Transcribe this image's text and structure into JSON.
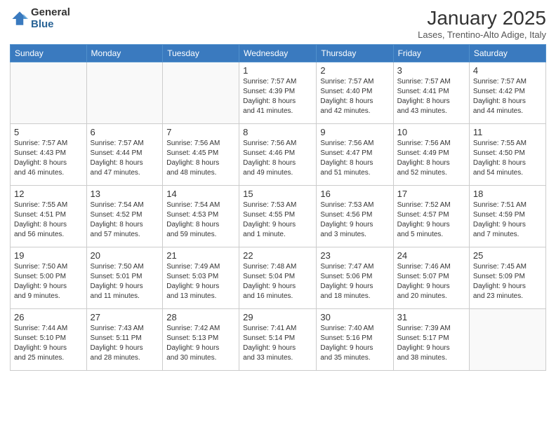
{
  "logo": {
    "general": "General",
    "blue": "Blue"
  },
  "header": {
    "month": "January 2025",
    "location": "Lases, Trentino-Alto Adige, Italy"
  },
  "weekdays": [
    "Sunday",
    "Monday",
    "Tuesday",
    "Wednesday",
    "Thursday",
    "Friday",
    "Saturday"
  ],
  "weeks": [
    [
      {
        "day": "",
        "detail": ""
      },
      {
        "day": "",
        "detail": ""
      },
      {
        "day": "",
        "detail": ""
      },
      {
        "day": "1",
        "detail": "Sunrise: 7:57 AM\nSunset: 4:39 PM\nDaylight: 8 hours\nand 41 minutes."
      },
      {
        "day": "2",
        "detail": "Sunrise: 7:57 AM\nSunset: 4:40 PM\nDaylight: 8 hours\nand 42 minutes."
      },
      {
        "day": "3",
        "detail": "Sunrise: 7:57 AM\nSunset: 4:41 PM\nDaylight: 8 hours\nand 43 minutes."
      },
      {
        "day": "4",
        "detail": "Sunrise: 7:57 AM\nSunset: 4:42 PM\nDaylight: 8 hours\nand 44 minutes."
      }
    ],
    [
      {
        "day": "5",
        "detail": "Sunrise: 7:57 AM\nSunset: 4:43 PM\nDaylight: 8 hours\nand 46 minutes."
      },
      {
        "day": "6",
        "detail": "Sunrise: 7:57 AM\nSunset: 4:44 PM\nDaylight: 8 hours\nand 47 minutes."
      },
      {
        "day": "7",
        "detail": "Sunrise: 7:56 AM\nSunset: 4:45 PM\nDaylight: 8 hours\nand 48 minutes."
      },
      {
        "day": "8",
        "detail": "Sunrise: 7:56 AM\nSunset: 4:46 PM\nDaylight: 8 hours\nand 49 minutes."
      },
      {
        "day": "9",
        "detail": "Sunrise: 7:56 AM\nSunset: 4:47 PM\nDaylight: 8 hours\nand 51 minutes."
      },
      {
        "day": "10",
        "detail": "Sunrise: 7:56 AM\nSunset: 4:49 PM\nDaylight: 8 hours\nand 52 minutes."
      },
      {
        "day": "11",
        "detail": "Sunrise: 7:55 AM\nSunset: 4:50 PM\nDaylight: 8 hours\nand 54 minutes."
      }
    ],
    [
      {
        "day": "12",
        "detail": "Sunrise: 7:55 AM\nSunset: 4:51 PM\nDaylight: 8 hours\nand 56 minutes."
      },
      {
        "day": "13",
        "detail": "Sunrise: 7:54 AM\nSunset: 4:52 PM\nDaylight: 8 hours\nand 57 minutes."
      },
      {
        "day": "14",
        "detail": "Sunrise: 7:54 AM\nSunset: 4:53 PM\nDaylight: 8 hours\nand 59 minutes."
      },
      {
        "day": "15",
        "detail": "Sunrise: 7:53 AM\nSunset: 4:55 PM\nDaylight: 9 hours\nand 1 minute."
      },
      {
        "day": "16",
        "detail": "Sunrise: 7:53 AM\nSunset: 4:56 PM\nDaylight: 9 hours\nand 3 minutes."
      },
      {
        "day": "17",
        "detail": "Sunrise: 7:52 AM\nSunset: 4:57 PM\nDaylight: 9 hours\nand 5 minutes."
      },
      {
        "day": "18",
        "detail": "Sunrise: 7:51 AM\nSunset: 4:59 PM\nDaylight: 9 hours\nand 7 minutes."
      }
    ],
    [
      {
        "day": "19",
        "detail": "Sunrise: 7:50 AM\nSunset: 5:00 PM\nDaylight: 9 hours\nand 9 minutes."
      },
      {
        "day": "20",
        "detail": "Sunrise: 7:50 AM\nSunset: 5:01 PM\nDaylight: 9 hours\nand 11 minutes."
      },
      {
        "day": "21",
        "detail": "Sunrise: 7:49 AM\nSunset: 5:03 PM\nDaylight: 9 hours\nand 13 minutes."
      },
      {
        "day": "22",
        "detail": "Sunrise: 7:48 AM\nSunset: 5:04 PM\nDaylight: 9 hours\nand 16 minutes."
      },
      {
        "day": "23",
        "detail": "Sunrise: 7:47 AM\nSunset: 5:06 PM\nDaylight: 9 hours\nand 18 minutes."
      },
      {
        "day": "24",
        "detail": "Sunrise: 7:46 AM\nSunset: 5:07 PM\nDaylight: 9 hours\nand 20 minutes."
      },
      {
        "day": "25",
        "detail": "Sunrise: 7:45 AM\nSunset: 5:09 PM\nDaylight: 9 hours\nand 23 minutes."
      }
    ],
    [
      {
        "day": "26",
        "detail": "Sunrise: 7:44 AM\nSunset: 5:10 PM\nDaylight: 9 hours\nand 25 minutes."
      },
      {
        "day": "27",
        "detail": "Sunrise: 7:43 AM\nSunset: 5:11 PM\nDaylight: 9 hours\nand 28 minutes."
      },
      {
        "day": "28",
        "detail": "Sunrise: 7:42 AM\nSunset: 5:13 PM\nDaylight: 9 hours\nand 30 minutes."
      },
      {
        "day": "29",
        "detail": "Sunrise: 7:41 AM\nSunset: 5:14 PM\nDaylight: 9 hours\nand 33 minutes."
      },
      {
        "day": "30",
        "detail": "Sunrise: 7:40 AM\nSunset: 5:16 PM\nDaylight: 9 hours\nand 35 minutes."
      },
      {
        "day": "31",
        "detail": "Sunrise: 7:39 AM\nSunset: 5:17 PM\nDaylight: 9 hours\nand 38 minutes."
      },
      {
        "day": "",
        "detail": ""
      }
    ]
  ]
}
